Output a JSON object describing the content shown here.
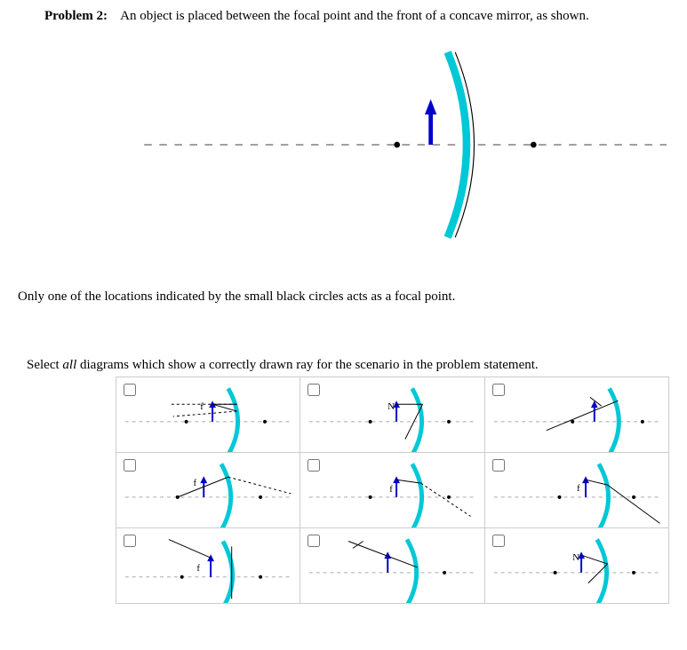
{
  "problem": {
    "label": "Problem 2:",
    "statement": "An object is placed between the focal point and the front of a concave mirror, as shown."
  },
  "note": "Only one of the locations indicated by the small black circles acts as a focal point.",
  "instruction_prefix": "Select ",
  "instruction_em": "all",
  "instruction_suffix": " diagrams which show a correctly drawn ray for the scenario in the problem statement.",
  "options": {
    "count": 9,
    "descriptions": [
      "Object arrow f, horizontal rays reflect back to left",
      "Object arrow N, single horizontal ray reflects through near focal region",
      "Object arrow, ray travels toward mirror at upward angle and reflects",
      "Object arrow f, ray toward mirror reflects outward to right",
      "Object arrow f, ray strikes mirror and reflects down-right",
      "Object arrow f, ray reflects downward to lower right",
      "Object arrow f, vertical-style configuration with ray to upper left",
      "Object arrow, oblique ray toward mirror, marking to right",
      "Object arrow N, ray reflects slightly downward right"
    ]
  }
}
